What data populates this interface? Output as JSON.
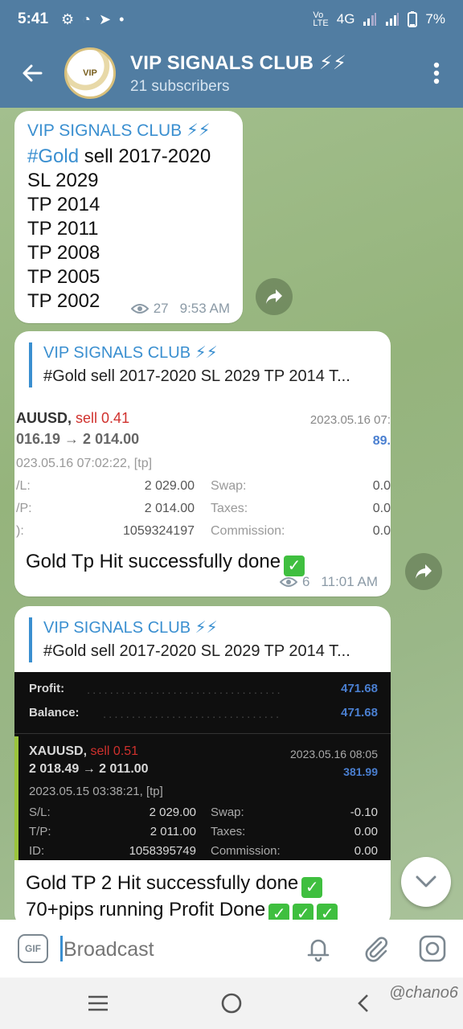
{
  "status_bar": {
    "time": "5:41",
    "network": "4G",
    "battery": "7%"
  },
  "header": {
    "title": "VIP SIGNALS CLUB ⚡⚡",
    "subtitle": "21 subscribers",
    "avatar_text": "VIP"
  },
  "messages": [
    {
      "sender": "VIP SIGNALS CLUB ⚡⚡",
      "hashtag": "#Gold",
      "lines": [
        "sell 2017-2020",
        "SL 2029",
        "TP 2014",
        "TP 2011",
        "TP 2008",
        "TP 2005",
        "TP 2002"
      ],
      "views": "27",
      "time": "9:53 AM"
    },
    {
      "reply_sender": "VIP SIGNALS CLUB ⚡⚡",
      "reply_text": "#Gold sell 2017-2020 SL 2029 TP 2014 T...",
      "screenshot": {
        "symbol": "AUUSD,",
        "side": "sell 0.41",
        "date": "2023.05.16 07:",
        "prices": "016.19 → 2 014.00",
        "profit": "89.",
        "closed": "023.05.16 07:02:22, [tp]",
        "sl_label": "/L:",
        "sl": "2 029.00",
        "tp_label": "/P:",
        "tp": "2 014.00",
        "id_label": "):",
        "id": "1059324197",
        "swap_label": "Swap:",
        "taxes_label": "Taxes:",
        "commission_label": "Commission:",
        "zero": "0.0"
      },
      "text": "Gold Tp Hit successfully done",
      "views": "6",
      "time": "11:01 AM"
    },
    {
      "reply_sender": "VIP SIGNALS CLUB ⚡⚡",
      "reply_text": "#Gold sell 2017-2020 SL 2029 TP 2014 T...",
      "screenshot": {
        "profit_label": "Profit:",
        "profit": "471.68",
        "balance_label": "Balance:",
        "balance": "471.68",
        "symbol": "XAUUSD,",
        "side": "sell 0.51",
        "date": "2023.05.16 08:05",
        "prices": "2 018.49 → 2 011.00",
        "trade_profit": "381.99",
        "opened": "2023.05.15 03:38:21, [tp]",
        "sl_label": "S/L:",
        "sl": "2 029.00",
        "tp_label": "T/P:",
        "tp": "2 011.00",
        "id_label": "ID:",
        "id": "1058395749",
        "swap_label": "Swap:",
        "swap": "-0.10",
        "taxes_label": "Taxes:",
        "taxes": "0.00",
        "commission_label": "Commission:",
        "commission": "0.00"
      },
      "text_line1": "Gold TP 2 Hit successfully done",
      "text_line2": "70+pips running Profit Done"
    }
  ],
  "input": {
    "gif_label": "GIF",
    "placeholder": "Broadcast"
  },
  "watermark": "@chano6",
  "colors": {
    "header": "#517da2",
    "accent": "#3a8fd0",
    "sell": "#d0312d",
    "profit_blue": "#4a7fd0"
  }
}
